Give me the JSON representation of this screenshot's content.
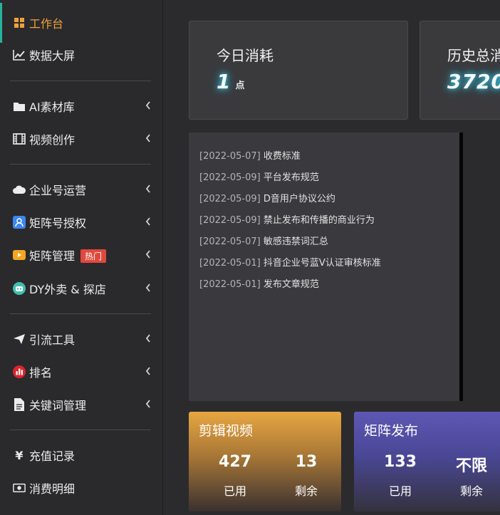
{
  "sidebar": {
    "items": [
      {
        "label": "工作台",
        "icon": "windows-icon",
        "active": true
      },
      {
        "label": "数据大屏",
        "icon": "line-chart-icon"
      },
      {
        "label": "AI素材库",
        "icon": "folder-icon"
      },
      {
        "label": "视频创作",
        "icon": "film-icon"
      },
      {
        "label": "企业号运营",
        "icon": "cloud-icon"
      },
      {
        "label": "矩阵号授权",
        "icon": "user-card-icon"
      },
      {
        "label": "矩阵管理",
        "icon": "video-play-icon",
        "badge": "热门"
      },
      {
        "label": "DY外卖 & 探店",
        "icon": "robot-icon"
      },
      {
        "label": "引流工具",
        "icon": "send-icon"
      },
      {
        "label": "排名",
        "icon": "bar-chart-icon"
      },
      {
        "label": "关键词管理",
        "icon": "document-icon"
      },
      {
        "label": "充值记录",
        "icon": "yen-icon"
      },
      {
        "label": "消费明细",
        "icon": "money-icon"
      }
    ]
  },
  "stats": {
    "today": {
      "title": "今日消耗",
      "value": "1",
      "unit": "点"
    },
    "history": {
      "title": "历史总消",
      "value": "3720."
    }
  },
  "notices": [
    {
      "date": "[2022-05-07]",
      "text": "收费标准"
    },
    {
      "date": "[2022-05-09]",
      "text": "平台发布规范"
    },
    {
      "date": "[2022-05-09]",
      "text": "D音用户协议公约"
    },
    {
      "date": "[2022-05-09]",
      "text": "禁止发布和传播的商业行为"
    },
    {
      "date": "[2022-05-07]",
      "text": "敏感违禁词汇总"
    },
    {
      "date": "[2022-05-01]",
      "text": "抖音企业号蓝V认证审核标准"
    },
    {
      "date": "[2022-05-01]",
      "text": "发布文章规范"
    }
  ],
  "usage": {
    "edit": {
      "title": "剪辑视频",
      "used": "427",
      "used_label": "已用",
      "left": "13",
      "left_label": "剩余"
    },
    "matrix": {
      "title": "矩阵发布",
      "used": "133",
      "used_label": "已用",
      "left": "不限",
      "left_label": "剩余"
    }
  },
  "colors": {
    "accent": "#f0a23a",
    "active_bar": "#27b39b",
    "hot_badge": "#e0483d",
    "glow": "#3ac8e6"
  }
}
